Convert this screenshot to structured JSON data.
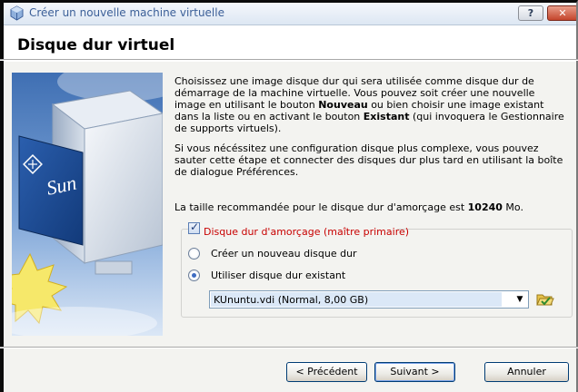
{
  "window": {
    "title": "Créer un nouvelle machine virtuelle",
    "help_label": "?",
    "close_label": "✕"
  },
  "page": {
    "title": "Disque dur virtuel"
  },
  "description": {
    "paragraph1_parts": [
      "Choisissez une image disque dur qui sera utilisée comme disque dur de démarrage de la machine virtuelle. Vous pouvez soit créer une nouvelle image en utilisant le bouton ",
      "Nouveau",
      " ou bien choisir une image existant dans la liste ou en activant le bouton ",
      "Existant",
      " (qui invoquera le Gestionnaire de supports virtuels)."
    ],
    "paragraph2": "Si vous nécéssitez une configuration disque plus complexe, vous pouvez sauter cette étape et connecter des disques dur plus tard en utilisant la boîte de dialogue Préférences."
  },
  "recommended": {
    "prefix": "La taille recommandée pour le disque dur d'amorçage est ",
    "value": "10240",
    "unit": " Mo."
  },
  "options": {
    "boot_disk_label": "Disque dur d'amorçage (maître primaire)",
    "boot_disk_checked": true,
    "create_new_label": "Créer un nouveau disque dur",
    "use_existing_label": "Utiliser disque dur existant",
    "selected_option": "use_existing",
    "existing_disk_value": "KUnuntu.vdi (Normal, 8,00 GB)"
  },
  "buttons": {
    "previous": "< Précédent",
    "next": "Suivant >",
    "cancel": "Annuler"
  },
  "artwork": {
    "brand_text": "Sun"
  }
}
